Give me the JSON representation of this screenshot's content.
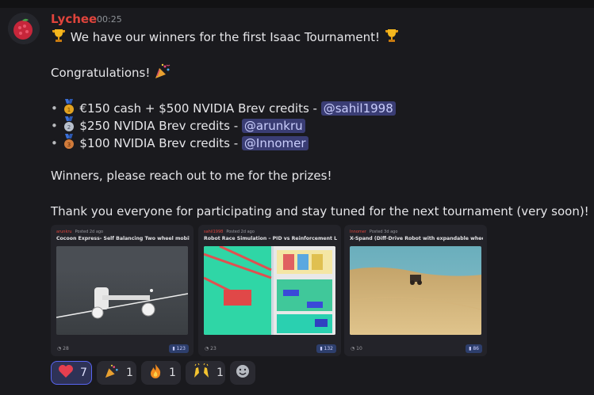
{
  "message": {
    "author": "Lychee",
    "time": "00:25",
    "line1": "We have our winners for the first Isaac Tournament!",
    "line2": "Congratulations!",
    "prizes": [
      {
        "text": "€150 cash + $500 NVIDIA Brev credits - ",
        "mention": "@sahil1998",
        "medal": "1"
      },
      {
        "text": "$250 NVIDIA Brev credits - ",
        "mention": "@arunkru",
        "medal": "2"
      },
      {
        "text": "$100 NVIDIA Brev credits - ",
        "mention": "@Innomer",
        "medal": "3"
      }
    ],
    "line3": "Winners, please reach out to me for the prizes!",
    "line4": "Thank you everyone for participating and stay tuned for the next tournament (very soon)!"
  },
  "embeds": [
    {
      "user": "arunkru",
      "posted": "Posted 2d ago",
      "title": "Cocoon Express- Self Balancing Two wheel mobile re...",
      "comments": "28",
      "views": "123"
    },
    {
      "user": "sahil1998",
      "posted": "Posted 2d ago",
      "title": "Robot Race Simulation – PID vs Reinforcement Learni...",
      "comments": "23",
      "views": "132"
    },
    {
      "user": "Innomer",
      "posted": "Posted 3d ago",
      "title": "X-Spand (Diff-Drive Robot with expandable wheels)",
      "comments": "10",
      "views": "86"
    }
  ],
  "reactions": [
    {
      "emoji": "heart",
      "count": "7",
      "active": true
    },
    {
      "emoji": "party-popper",
      "count": "1"
    },
    {
      "emoji": "fire",
      "count": "1"
    },
    {
      "emoji": "raised-hands",
      "count": "1"
    }
  ],
  "icons": {
    "trophy": "trophy-icon",
    "add_reaction": "smiley-add-icon",
    "comment": "comment-icon",
    "views": "view-icon"
  },
  "colors": {
    "author": "#e0443c",
    "mention_bg": "#3a3d74",
    "mention_text": "#c9cdfb",
    "active_reaction_border": "#5865f2"
  }
}
